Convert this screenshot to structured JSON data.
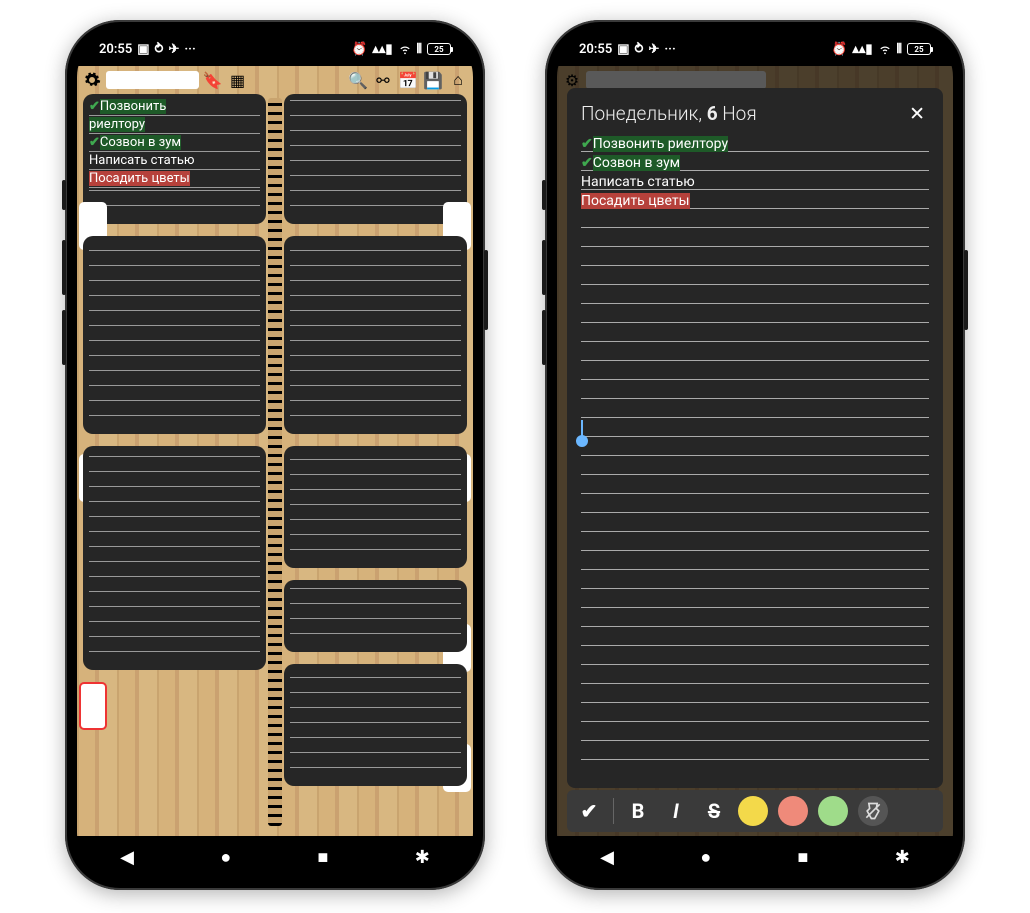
{
  "status": {
    "time": "20:55",
    "battery": "25"
  },
  "left_screen": {
    "tasks": [
      {
        "check": true,
        "text": "Позвонить",
        "hl": "green"
      },
      {
        "check": false,
        "text": "риелтору",
        "hl": "green"
      },
      {
        "check": true,
        "text": "Созвон в зум",
        "hl": "green"
      },
      {
        "check": false,
        "text": "Написать статью",
        "hl": "none"
      },
      {
        "check": false,
        "text": "Посадить цветы",
        "hl": "red"
      }
    ]
  },
  "right_screen": {
    "title_prefix": "Понедельник, ",
    "title_day": "6",
    "title_suffix": " Ноя",
    "tasks": [
      {
        "check": true,
        "text": "Позвонить риелтору",
        "hl": "green"
      },
      {
        "check": true,
        "text": "Созвон в зум",
        "hl": "green"
      },
      {
        "check": false,
        "text": "Написать статью",
        "hl": "none"
      },
      {
        "check": false,
        "text": "Посадить цветы",
        "hl": "red"
      }
    ],
    "format_labels": {
      "check": "✔",
      "bold": "B",
      "italic": "I",
      "strike": "S"
    }
  },
  "colors": {
    "yellow": "#f3d94a",
    "red": "#ef8a7a",
    "green": "#9fdc8a"
  }
}
